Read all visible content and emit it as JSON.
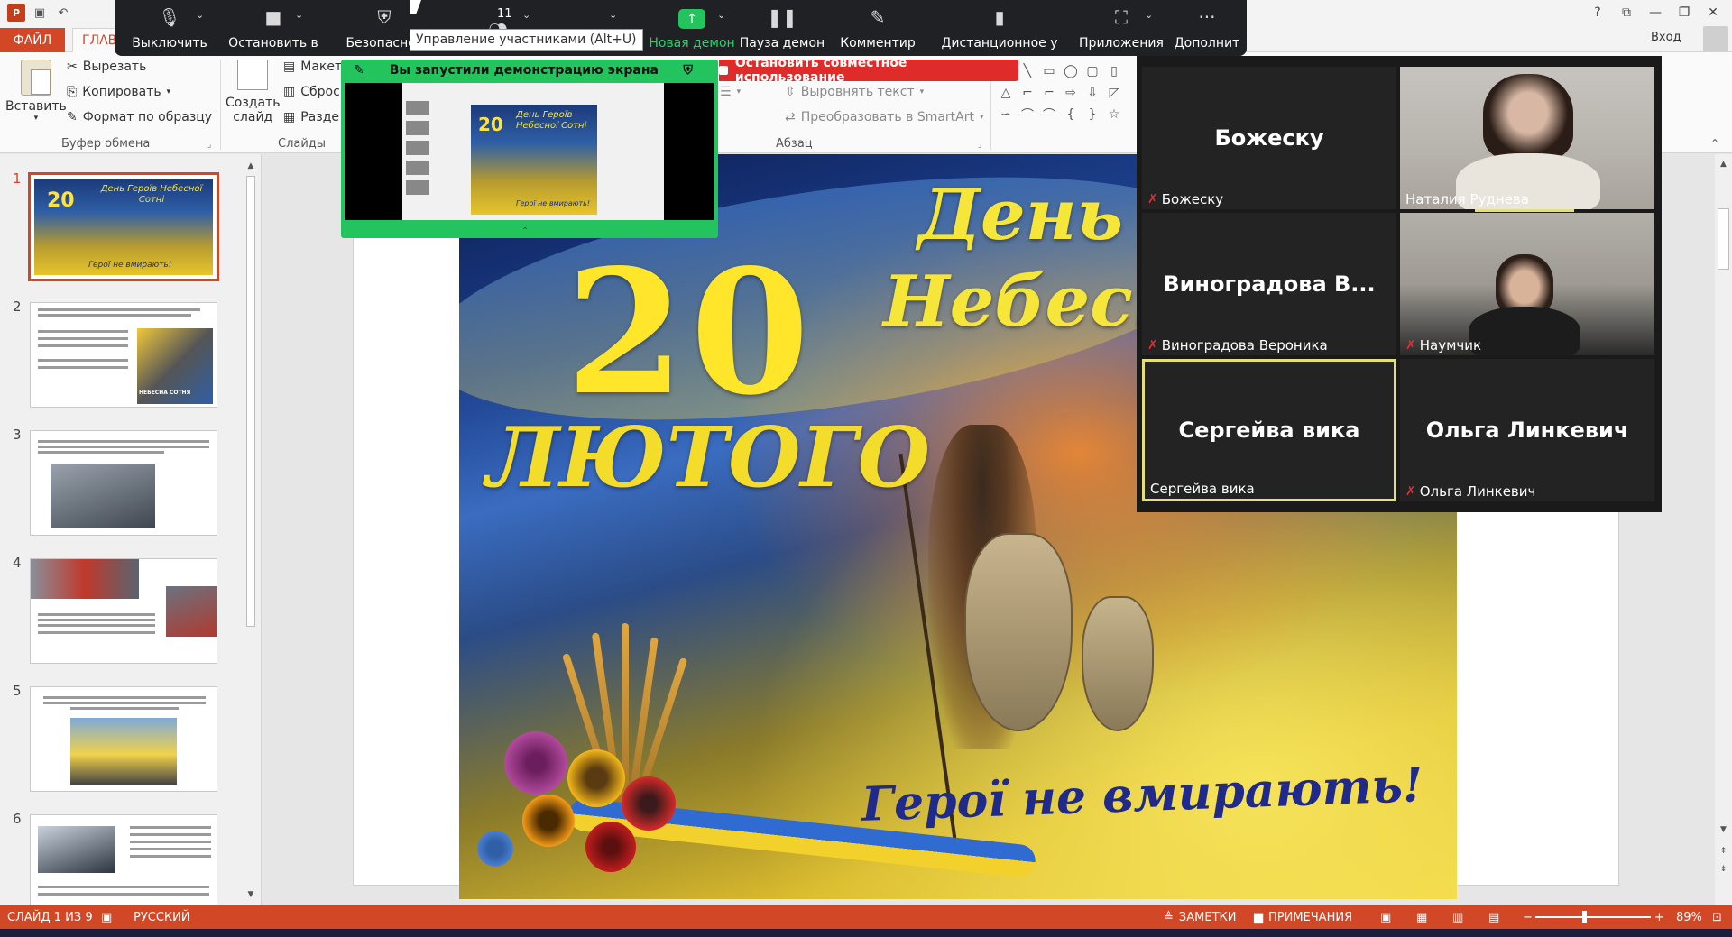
{
  "app": {
    "logo_letter": "P",
    "login": "Вход"
  },
  "ribbon_tabs": {
    "file": "ФАЙЛ",
    "home": "ГЛАВ"
  },
  "ribbon": {
    "paste": "Вставить",
    "cut": "Вырезать",
    "copy": "Копировать",
    "format_painter": "Формат по образцу",
    "clipboard_group": "Буфер обмена",
    "new_slide_line1": "Создать",
    "new_slide_line2": "слайд",
    "layout": "Макет",
    "reset": "Сброс",
    "section": "Разде",
    "slides_group": "Слайды",
    "align_text": "Выровнять текст",
    "convert_smartart": "Преобразовать в SmartArt",
    "paragraph_group": "Абзац"
  },
  "zoom_toolbar": {
    "mute": "Выключить",
    "stop_video": "Остановить в",
    "security": "Безопаснос",
    "participants_count": "11",
    "new_share": "Новая демон",
    "pause_share": "Пауза демон",
    "annotate": "Комментир",
    "remote_control": "Дистанционное у",
    "apps": "Приложения",
    "more": "Дополнит",
    "tooltip": "Управление участниками (Alt+U)"
  },
  "share": {
    "notice": "Вы запустили демонстрацию экрана",
    "stop": "Остановить совместное использование"
  },
  "gallery": {
    "tiles": [
      {
        "center": "Божеску",
        "label": "Божеску",
        "muted": true,
        "video": false
      },
      {
        "center": "",
        "label": "Наталия Руднева",
        "muted": false,
        "video": true
      },
      {
        "center": "Виноградова  В...",
        "label": "Виноградова Вероника",
        "muted": true,
        "video": false
      },
      {
        "center": "",
        "label": "Наумчик",
        "muted": true,
        "video": true
      },
      {
        "center": "Сергейва вика",
        "label": "Сергейва вика",
        "muted": false,
        "video": false,
        "active": true
      },
      {
        "center": "Ольга Линкевич",
        "label": "Ольга Линкевич",
        "muted": true,
        "video": false
      }
    ]
  },
  "thumbnails": {
    "numbers": [
      "1",
      "2",
      "3",
      "4",
      "5",
      "6"
    ],
    "slide1_day": "День Героїв Небесної Сотні",
    "slide1_date": "20",
    "slide1_month": "ЛЮТОГО",
    "slide1_footer": "Герої не вмирають!",
    "slide2_badge": "НЕБЕСНА СОТНЯ"
  },
  "slide": {
    "date": "20",
    "month": "ЛЮТОГО",
    "day_line1": "День Г",
    "day_line2": "Небесно",
    "heroes": "Герої не вмирають!"
  },
  "status": {
    "slide_of": "СЛАЙД 1 ИЗ 9",
    "language": "РУССКИЙ",
    "notes": "ЗАМЕТКИ",
    "comments": "ПРИМЕЧАНИЯ",
    "zoom": "89%"
  },
  "colors": {
    "ppt_accent": "#d24726",
    "zoom_green": "#23c45e",
    "zoom_red": "#e02b2b",
    "zoom_toolbar": "#202124",
    "active_speaker": "#e3e07a"
  }
}
